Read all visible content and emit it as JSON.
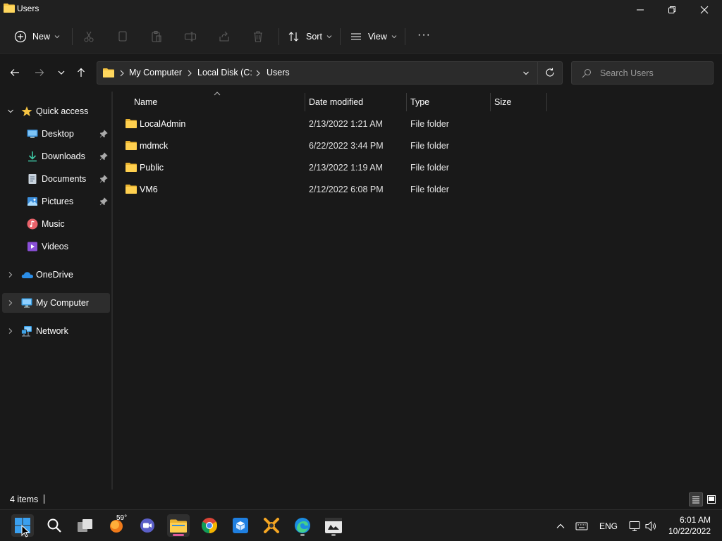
{
  "window": {
    "title": "Users"
  },
  "toolbar": {
    "new_label": "New",
    "sort_label": "Sort",
    "view_label": "View",
    "more_label": "···"
  },
  "address": {
    "crumbs": [
      "My Computer",
      "Local Disk (C:",
      "Users"
    ],
    "search_placeholder": "Search Users"
  },
  "sidebar": {
    "items": [
      {
        "label": "Quick access",
        "icon": "star-icon"
      },
      {
        "label": "Desktop",
        "icon": "desktop-icon",
        "pinned": true
      },
      {
        "label": "Downloads",
        "icon": "download-icon",
        "pinned": true
      },
      {
        "label": "Documents",
        "icon": "document-icon",
        "pinned": true
      },
      {
        "label": "Pictures",
        "icon": "pictures-icon",
        "pinned": true
      },
      {
        "label": "Music",
        "icon": "music-icon"
      },
      {
        "label": "Videos",
        "icon": "videos-icon"
      },
      {
        "label": "OneDrive",
        "icon": "cloud-icon"
      },
      {
        "label": "My Computer",
        "icon": "computer-icon",
        "selected": true
      },
      {
        "label": "Network",
        "icon": "network-icon"
      }
    ]
  },
  "filelist": {
    "columns": [
      "Name",
      "Date modified",
      "Type",
      "Size"
    ],
    "rows": [
      {
        "name": "LocalAdmin",
        "date": "2/13/2022 1:21 AM",
        "type": "File folder"
      },
      {
        "name": "mdmck",
        "date": "6/22/2022 3:44 PM",
        "type": "File folder"
      },
      {
        "name": "Public",
        "date": "2/13/2022 1:19 AM",
        "type": "File folder"
      },
      {
        "name": "VM6",
        "date": "2/12/2022 6:08 PM",
        "type": "File folder"
      }
    ]
  },
  "status": {
    "item_count": "4 items"
  },
  "taskbar": {
    "weather": "59°",
    "tray_language": "ENG",
    "time": "6:01 AM",
    "date": "10/22/2022"
  },
  "colors": {
    "folder": "#f5c342",
    "accent": "#4cc2ff",
    "background": "#191919"
  }
}
